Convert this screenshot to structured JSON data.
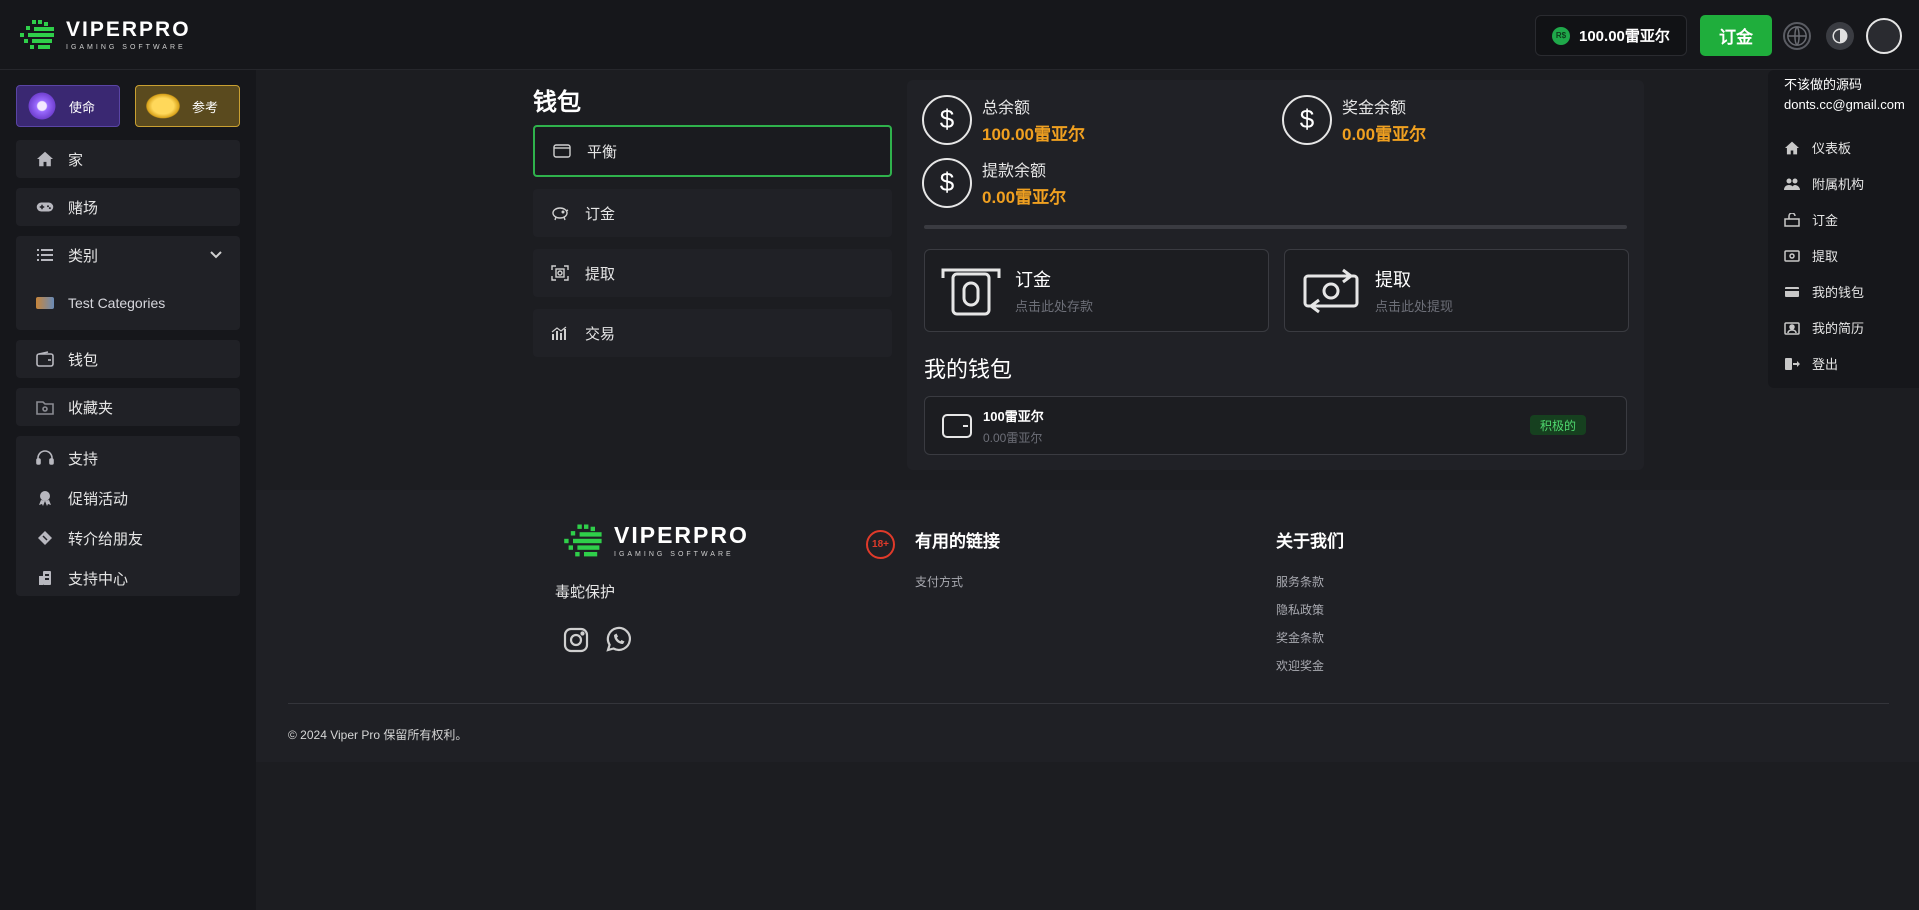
{
  "brand": {
    "name": "VIPERPRO",
    "sub": "IGAMING SOFTWARE"
  },
  "header": {
    "currency_icon": "R$",
    "balance": "100.00雷亚尔",
    "deposit_label": "订金",
    "icons": [
      "globe-icon",
      "theme-toggle-icon",
      "avatar"
    ]
  },
  "sidebar": {
    "promo_mission": "使命",
    "promo_referral": "参考",
    "items": [
      {
        "label": "家",
        "icon": "home-icon"
      },
      {
        "label": "赌场",
        "icon": "gamepad-icon"
      },
      {
        "label": "类别",
        "icon": "list-icon"
      },
      {
        "label": "Test Categories",
        "icon": "category-thumbnail"
      },
      {
        "label": "钱包",
        "icon": "wallet-icon"
      },
      {
        "label": "收藏夹",
        "icon": "folder-icon"
      },
      {
        "label": "支持",
        "icon": "headset-icon"
      },
      {
        "label": "促销活动",
        "icon": "promo-icon"
      },
      {
        "label": "转介给朋友",
        "icon": "ticket-icon"
      },
      {
        "label": "支持中心",
        "icon": "help-center-icon"
      }
    ]
  },
  "wallet": {
    "title": "钱包",
    "menu": [
      {
        "label": "平衡",
        "icon": "wallet-icon"
      },
      {
        "label": "订金",
        "icon": "piggy-bank-icon"
      },
      {
        "label": "提取",
        "icon": "withdraw-icon"
      },
      {
        "label": "交易",
        "icon": "chart-icon"
      }
    ],
    "balances": [
      {
        "label": "总余额",
        "value": "100.00雷亚尔"
      },
      {
        "label": "奖金余额",
        "value": "0.00雷亚尔"
      },
      {
        "label": "提款余额",
        "value": "0.00雷亚尔"
      }
    ],
    "actions": [
      {
        "title": "订金",
        "sub": "点击此处存款"
      },
      {
        "title": "提取",
        "sub": "点击此处提现"
      }
    ],
    "my_wallet_title": "我的钱包",
    "row": {
      "name": "100雷亚尔",
      "sub": "0.00雷亚尔",
      "status": "积极的"
    }
  },
  "dropdown": {
    "username": "不该做的源码",
    "email": "donts.cc@gmail.com",
    "items": [
      {
        "label": "仪表板",
        "icon": "home-icon"
      },
      {
        "label": "附属机构",
        "icon": "users-icon"
      },
      {
        "label": "订金",
        "icon": "deposit-icon"
      },
      {
        "label": "提取",
        "icon": "withdraw-icon"
      },
      {
        "label": "我的钱包",
        "icon": "wallet-icon"
      },
      {
        "label": "我的简历",
        "icon": "id-card-icon"
      },
      {
        "label": "登出",
        "icon": "logout-icon"
      }
    ]
  },
  "footer": {
    "tagline": "毒蛇保护",
    "age": "18+",
    "useful_links_title": "有用的链接",
    "useful_links": [
      "支付方式"
    ],
    "about_title": "关于我们",
    "about_links": [
      "服务条款",
      "隐私政策",
      "奖金条款",
      "欢迎奖金"
    ],
    "copyright": "© 2024 Viper Pro 保留所有权利。"
  },
  "colors": {
    "accent_green": "#1fae3c",
    "amount_orange": "#f0a020",
    "badge_green": "#4fd86e"
  }
}
